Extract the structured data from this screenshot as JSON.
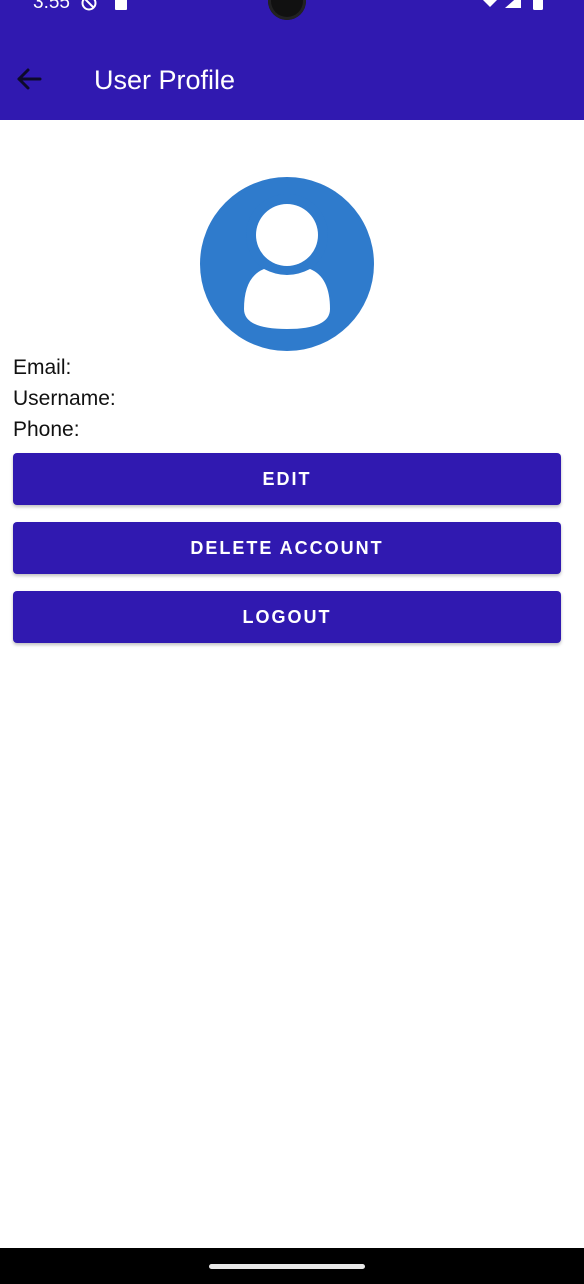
{
  "status_bar": {
    "time": "3:55"
  },
  "header": {
    "title": "User Profile",
    "back_icon": "arrow-back-icon"
  },
  "avatar": {
    "icon": "account-circle-icon",
    "color": "#2f7bcc"
  },
  "profile": {
    "email_label": "Email:",
    "username_label": "Username:",
    "phone_label": "Phone:"
  },
  "actions": {
    "edit_label": "EDIT",
    "delete_label": "DELETE ACCOUNT",
    "logout_label": "LOGOUT"
  },
  "colors": {
    "primary": "#3019b0",
    "avatar": "#2f7bcc",
    "background": "#ffffff"
  }
}
